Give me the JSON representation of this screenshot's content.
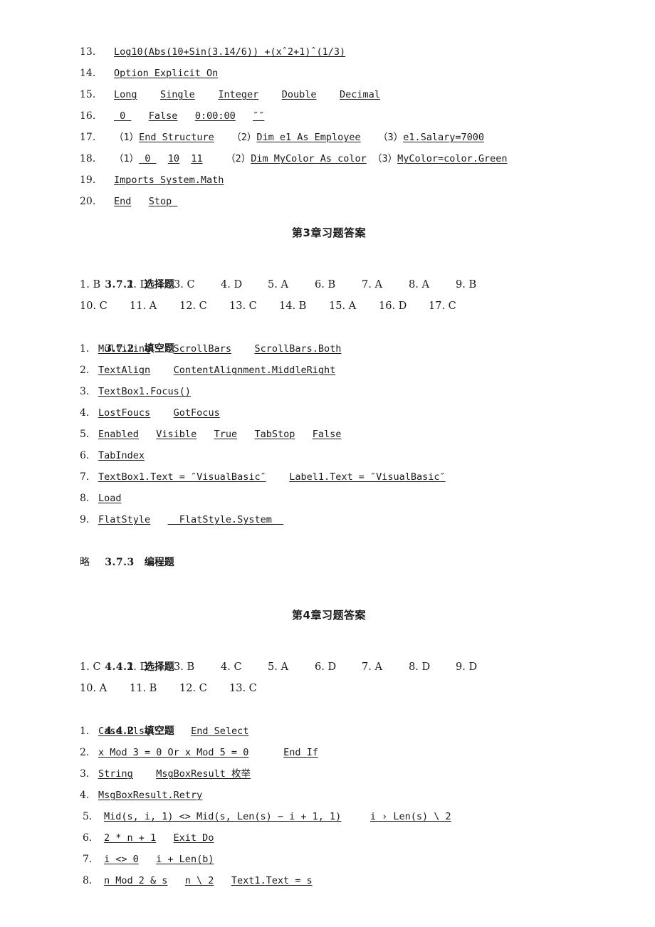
{
  "document": {
    "kind": "textbook-answer-key",
    "background_color": "#ffffff",
    "text_color": "#1a1a1a"
  },
  "chapter2_tail": {
    "items": [
      {
        "num": "13.",
        "segments": [
          {
            "text": "Log10(Abs(10+Sin(3.14/6)) +(xˆ2+1)ˆ(1/3)",
            "underline": true
          }
        ]
      },
      {
        "num": "14.",
        "segments": [
          {
            "text": "Option Explicit On",
            "underline": true
          }
        ]
      },
      {
        "num": "15.",
        "segments": [
          {
            "text": "Long",
            "underline": true
          },
          {
            "text": "    ",
            "underline": false
          },
          {
            "text": "Single",
            "underline": true
          },
          {
            "text": "    ",
            "underline": false
          },
          {
            "text": "Integer",
            "underline": true
          },
          {
            "text": "    ",
            "underline": false
          },
          {
            "text": "Double",
            "underline": true
          },
          {
            "text": "    ",
            "underline": false
          },
          {
            "text": "Decimal",
            "underline": true
          }
        ]
      },
      {
        "num": "16.",
        "segments": [
          {
            "text": " 0 ",
            "underline": true
          },
          {
            "text": "   ",
            "underline": false
          },
          {
            "text": "False",
            "underline": true
          },
          {
            "text": "   ",
            "underline": false
          },
          {
            "text": "0:00:00",
            "underline": true
          },
          {
            "text": "   ",
            "underline": false
          },
          {
            "text": "″″",
            "underline": true
          }
        ]
      },
      {
        "num": "17.",
        "segments": [
          {
            "text": "（1）",
            "underline": false
          },
          {
            "text": "End Structure",
            "underline": true
          },
          {
            "text": "   ",
            "underline": false
          },
          {
            "text": "（2）",
            "underline": false
          },
          {
            "text": "Dim e1 As Employee",
            "underline": true
          },
          {
            "text": "   ",
            "underline": false
          },
          {
            "text": "（3）",
            "underline": false
          },
          {
            "text": "e1.Salary=7000",
            "underline": true
          }
        ]
      },
      {
        "num": "18.",
        "segments": [
          {
            "text": "（1）",
            "underline": false
          },
          {
            "text": " 0 ",
            "underline": true
          },
          {
            "text": "  ",
            "underline": false
          },
          {
            "text": "10",
            "underline": true
          },
          {
            "text": "  ",
            "underline": false
          },
          {
            "text": "11",
            "underline": true
          },
          {
            "text": "    ",
            "underline": false
          },
          {
            "text": "（2）",
            "underline": false
          },
          {
            "text": "Dim MyColor As color",
            "underline": true
          },
          {
            "text": " ",
            "underline": false
          },
          {
            "text": "（3）",
            "underline": false
          },
          {
            "text": "MyColor=color.Green",
            "underline": true
          }
        ]
      },
      {
        "num": "19.",
        "segments": [
          {
            "text": "Imports System.Math",
            "underline": true
          }
        ]
      },
      {
        "num": "20.",
        "segments": [
          {
            "text": "End",
            "underline": true
          },
          {
            "text": "   ",
            "underline": false
          },
          {
            "text": "Stop ",
            "underline": true
          }
        ]
      }
    ]
  },
  "chapter3": {
    "title": "第3章习题答案",
    "sections": {
      "choice": {
        "number": "3.7.1",
        "label": "选择题",
        "rows": [
          [
            "1. B",
            "2. D",
            "3. C",
            "4. D",
            "5. A",
            "6. B",
            "7. A",
            "8. A",
            "9. B"
          ],
          [
            "10. C",
            "11. A",
            "12. C",
            "13. C",
            "14. B",
            "15. A",
            "16. D",
            "17. C"
          ]
        ]
      },
      "blank": {
        "number": "3.7.2",
        "label": "填空题",
        "items": [
          {
            "num": "1.",
            "segments": [
              {
                "text": "Multiline",
                "underline": true
              },
              {
                "text": "    ",
                "underline": false
              },
              {
                "text": "ScrollBars",
                "underline": true
              },
              {
                "text": "    ",
                "underline": false
              },
              {
                "text": "ScrollBars.Both",
                "underline": true
              }
            ]
          },
          {
            "num": "2.",
            "segments": [
              {
                "text": "TextAlign",
                "underline": true
              },
              {
                "text": "    ",
                "underline": false
              },
              {
                "text": "ContentAlignment.MiddleRight",
                "underline": true
              }
            ]
          },
          {
            "num": "3.",
            "segments": [
              {
                "text": "TextBox1.Focus()",
                "underline": true
              }
            ]
          },
          {
            "num": "4.",
            "segments": [
              {
                "text": "LostFoucs",
                "underline": true
              },
              {
                "text": "    ",
                "underline": false
              },
              {
                "text": "GotFocus",
                "underline": true
              }
            ]
          },
          {
            "num": "5.",
            "segments": [
              {
                "text": "Enabled",
                "underline": true
              },
              {
                "text": "   ",
                "underline": false
              },
              {
                "text": "Visible",
                "underline": true
              },
              {
                "text": "   ",
                "underline": false
              },
              {
                "text": "True",
                "underline": true
              },
              {
                "text": "   ",
                "underline": false
              },
              {
                "text": "TabStop",
                "underline": true
              },
              {
                "text": "   ",
                "underline": false
              },
              {
                "text": "False",
                "underline": true
              }
            ]
          },
          {
            "num": "6.",
            "segments": [
              {
                "text": "TabIndex",
                "underline": true
              }
            ]
          },
          {
            "num": "7.",
            "segments": [
              {
                "text": "TextBox1.Text = ″VisualBasic″",
                "underline": true
              },
              {
                "text": "    ",
                "underline": false
              },
              {
                "text": "Label1.Text = ″VisualBasic″",
                "underline": true
              }
            ]
          },
          {
            "num": "8.",
            "segments": [
              {
                "text": "Load",
                "underline": true
              }
            ]
          },
          {
            "num": "9.",
            "segments": [
              {
                "text": "FlatStyle",
                "underline": true
              },
              {
                "text": "   ",
                "underline": false
              },
              {
                "text": "  FlatStyle.System  ",
                "underline": true
              }
            ]
          }
        ]
      },
      "program": {
        "number": "3.7.3",
        "label": "编程题",
        "body": "略"
      }
    }
  },
  "chapter4": {
    "title": "第4章习题答案",
    "sections": {
      "choice": {
        "number": "4.4.1",
        "label": "选择题",
        "rows": [
          [
            "1. C",
            "2. D",
            "3. B",
            "4. C",
            "5. A",
            "6. D",
            "7. A",
            "8. D",
            "9. D"
          ],
          [
            "10. A",
            "11. B",
            "12. C",
            "13. C"
          ]
        ]
      },
      "blank": {
        "number": "4.4.2",
        "label": "填空题",
        "items": [
          {
            "num": "1.",
            "segments": [
              {
                "text": "Case Else",
                "underline": true
              },
              {
                "text": "       ",
                "underline": false
              },
              {
                "text": "End Select",
                "underline": true
              }
            ]
          },
          {
            "num": "2.",
            "segments": [
              {
                "text": "x Mod 3 = 0 Or x Mod 5 = 0",
                "underline": true
              },
              {
                "text": "      ",
                "underline": false
              },
              {
                "text": "End If",
                "underline": true
              }
            ]
          },
          {
            "num": "3.",
            "segments": [
              {
                "text": "String",
                "underline": true
              },
              {
                "text": "    ",
                "underline": false
              },
              {
                "text": "MsgBoxResult 枚举",
                "underline": true
              }
            ]
          },
          {
            "num": "4.",
            "segments": [
              {
                "text": "MsgBoxResult.Retry",
                "underline": true
              }
            ]
          },
          {
            "num": "5.",
            "indent": true,
            "segments": [
              {
                "text": "Mid(s, i, 1) <> Mid(s, Len(s) − i + 1, 1)",
                "underline": true
              },
              {
                "text": "     ",
                "underline": false
              },
              {
                "text": "i › Len(s) \\ 2",
                "underline": true
              }
            ]
          },
          {
            "num": "6.",
            "indent": true,
            "segments": [
              {
                "text": "2 * n + 1",
                "underline": true
              },
              {
                "text": "   ",
                "underline": false
              },
              {
                "text": "Exit Do",
                "underline": true
              }
            ]
          },
          {
            "num": "7.",
            "indent": true,
            "segments": [
              {
                "text": "i <> 0",
                "underline": true
              },
              {
                "text": "   ",
                "underline": false
              },
              {
                "text": "i + Len(b)",
                "underline": true
              }
            ]
          },
          {
            "num": "8.",
            "indent": true,
            "segments": [
              {
                "text": "n Mod 2 & s",
                "underline": true
              },
              {
                "text": "   ",
                "underline": false
              },
              {
                "text": "n \\ 2",
                "underline": true
              },
              {
                "text": "   ",
                "underline": false
              },
              {
                "text": "Text1.Text = s",
                "underline": true
              }
            ]
          }
        ]
      }
    }
  }
}
